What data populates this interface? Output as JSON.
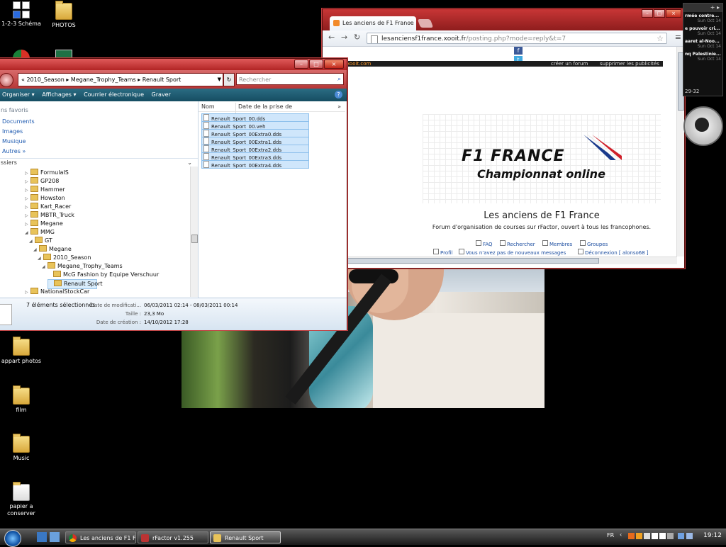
{
  "desktop": {
    "icons": [
      {
        "label": "1-2-3 Schéma"
      },
      {
        "label": "PHOTOS"
      },
      {
        "label": "appart photos"
      },
      {
        "label": "film"
      },
      {
        "label": "Music"
      },
      {
        "label": "papier a conserver"
      }
    ]
  },
  "explorer": {
    "breadcrumb": [
      "«",
      "2010_Season",
      "▸",
      "Megane_Trophy_Teams",
      "▸",
      "Renault Sport"
    ],
    "breadcrumb_text": "«  2010_Season  ▸  Megane_Trophy_Teams  ▸  Renault Sport",
    "search_placeholder": "Rechercher",
    "toolbar": {
      "organize": "Organiser ▾",
      "views": "Affichages ▾",
      "email": "Courrier électronique",
      "burn": "Graver"
    },
    "favorites_header": "ns favoris",
    "favorites": [
      "Documents",
      "Images",
      "Musique",
      "Autres  »"
    ],
    "folders_header": "ssiers",
    "tree": [
      "FormulaIS",
      "GP208",
      "Hammer",
      "Howston",
      "Kart_Racer",
      "MBTR_Truck",
      "Megane",
      "MMG",
      "GT",
      "Megane",
      "2010_Season",
      "Megane_Trophy_Teams",
      "McG Fashion by Equipe Verschuur",
      "Renault Sport",
      "NationalStockCar"
    ],
    "columns": {
      "name": "Nom",
      "date": "Date de la prise de vue"
    },
    "files": [
      "Renault_Sport_00.dds",
      "Renault_Sport_00.veh",
      "Renault_Sport_00Extra0.dds",
      "Renault_Sport_00Extra1.dds",
      "Renault_Sport_00Extra2.dds",
      "Renault_Sport_00Extra3.dds",
      "Renault_Sport_00Extra4.dds"
    ],
    "details": {
      "selected": "7 éléments sélectionnés",
      "modified_label": "Date de modificati...",
      "modified_value": "06/03/2011 02:14 - 08/03/2011 00:14",
      "size_label": "Taille :",
      "size_value": "23,3 Mo",
      "created_label": "Date de création :",
      "created_value": "14/10/2012 17:28"
    }
  },
  "browser": {
    "tab_title": "Les anciens de F1 France :",
    "url_host": "lesanciensf1france.xooit.fr",
    "url_path": "/posting.php?mode=reply&t=7",
    "darkbar": {
      "xooit": "xooit.com",
      "link1": "créer un forum",
      "link2": "supprimer les publicités"
    },
    "logo_text": "F1 FRANCE",
    "logo_sub": "Championnat online",
    "forum_title": "Les anciens de F1 France",
    "forum_desc": "Forum d'organisation de courses sur rFactor, ouvert à tous les francophones.",
    "links": {
      "faq": "FAQ",
      "search": "Rechercher",
      "members": "Membres",
      "groups": "Groupes",
      "profile": "Profil",
      "messages": "Vous n'avez pas de nouveaux messages",
      "logout": "Déconnexion [ alonso68 ]"
    }
  },
  "news_gadget": {
    "items": [
      {
        "headline": "rmée contre...",
        "date": "Sun Oct 14"
      },
      {
        "headline": "e pouvoir cri...",
        "date": "Sun Oct 14"
      },
      {
        "headline": "aaret al-Noo...",
        "date": "Sun Oct 14"
      },
      {
        "headline": "nq Palestinie...",
        "date": "Sun Oct 14"
      }
    ],
    "footer": "29-32"
  },
  "taskbar": {
    "buttons": [
      "Les anciens de F1 Fr...",
      "rFactor v1.255",
      "Renault Sport"
    ],
    "lang": "FR",
    "clock": "19:12"
  }
}
